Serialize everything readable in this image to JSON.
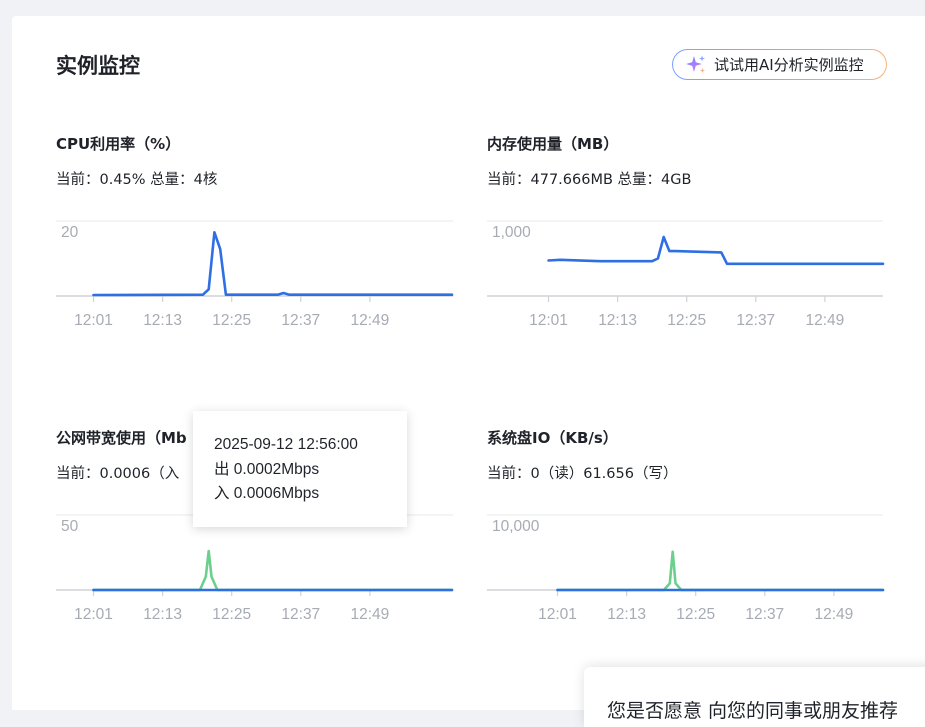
{
  "page": {
    "title": "实例监控",
    "ai_button_label": "试试用AI分析实例监控"
  },
  "panels": {
    "cpu": {
      "title": "CPU利用率（%）",
      "current": "当前：0.45% 总量：4核"
    },
    "memory": {
      "title": "内存使用量（MB）",
      "current": "当前：477.666MB 总量：4GB"
    },
    "bandwidth": {
      "title": "公网带宽使用（Mb",
      "current": "当前：0.0006（入"
    },
    "disk": {
      "title": "系统盘IO（KB/s）",
      "current": "当前：0（读）61.656（写）"
    }
  },
  "tooltip": {
    "time": "2025-09-12 12:56:00",
    "out": "出 0.0002Mbps",
    "in": "入 0.0006Mbps"
  },
  "survey": {
    "text": "您是否愿意 向您的同事或朋友推荐"
  },
  "colors": {
    "cpu_line": "#2f6fe4",
    "memory_line": "#2f6fe4",
    "out_line": "#2f6fe4",
    "in_line": "#6ccf8c",
    "disk_write": "#2f6fe4",
    "disk_read": "#6ccf8c",
    "grid": "#e8e9eb",
    "axis": "#cfd2d6"
  },
  "icons": {
    "ai_button": "sparkle-icon"
  },
  "chart_data": [
    {
      "id": "cpu",
      "type": "line",
      "categories": [
        "12:01",
        "12:13",
        "12:25",
        "12:37",
        "12:49"
      ],
      "ytick_labels": [
        "20"
      ],
      "ylim": [
        0,
        20
      ],
      "x_minutes": [
        1,
        20,
        21,
        22,
        23,
        24,
        33,
        34,
        35,
        59
      ],
      "series": [
        {
          "values": [
            0.3,
            0.4,
            2,
            19,
            14,
            0.4,
            0.4,
            0.9,
            0.4,
            0.4
          ]
        }
      ]
    },
    {
      "id": "memory",
      "type": "line",
      "categories": [
        "12:01",
        "12:13",
        "12:25",
        "12:37",
        "12:49"
      ],
      "ytick_labels": [
        "1,000"
      ],
      "ylim": [
        0,
        1000
      ],
      "x_minutes": [
        1,
        3,
        10,
        19,
        20,
        21,
        22,
        23,
        31,
        32,
        33,
        59
      ],
      "series": [
        {
          "values": [
            530,
            540,
            520,
            520,
            560,
            880,
            670,
            670,
            650,
            480,
            480,
            480
          ]
        }
      ]
    },
    {
      "id": "bandwidth",
      "type": "line",
      "categories": [
        "12:01",
        "12:13",
        "12:25",
        "12:37",
        "12:49"
      ],
      "ytick_labels": [
        "50"
      ],
      "ylim": [
        0,
        50
      ],
      "x_minutes": [
        1,
        19.5,
        20.5,
        21,
        21.5,
        22.5,
        59
      ],
      "series": [
        {
          "values": [
            0.1,
            0.1,
            10,
            29,
            10,
            0.1,
            0.1
          ]
        },
        {
          "values": [
            0,
            0,
            0,
            0,
            0,
            0,
            0
          ]
        }
      ]
    },
    {
      "id": "disk",
      "type": "line",
      "categories": [
        "12:01",
        "12:13",
        "12:25",
        "12:37",
        "12:49"
      ],
      "ytick_labels": [
        "10,000"
      ],
      "ylim": [
        0,
        10000
      ],
      "x_minutes": [
        1,
        19.5,
        20.5,
        21,
        21.5,
        22.5,
        59
      ],
      "series": [
        {
          "values": [
            10,
            10,
            1000,
            5700,
            1000,
            10,
            10
          ]
        },
        {
          "values": [
            0,
            0,
            0,
            0,
            0,
            0,
            0
          ]
        }
      ]
    }
  ]
}
